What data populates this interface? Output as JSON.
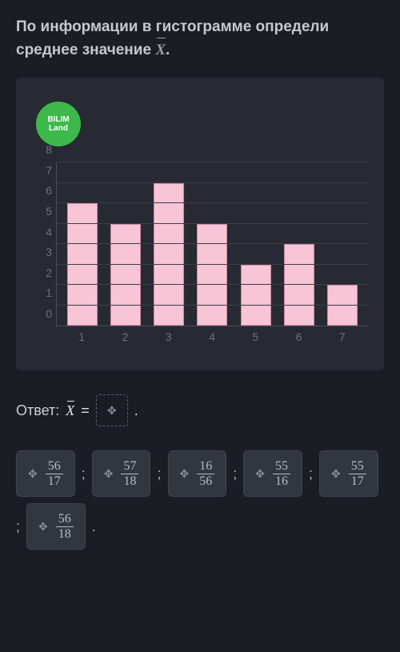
{
  "question": {
    "line1": "По информации в гистограмме определи",
    "line2_prefix": "среднее значение ",
    "line2_suffix": "."
  },
  "logo": {
    "line1": "BILIM",
    "line2": "Land"
  },
  "chart_data": {
    "type": "bar",
    "categories": [
      "1",
      "2",
      "3",
      "4",
      "5",
      "6",
      "7"
    ],
    "values": [
      6,
      5,
      7,
      5,
      3,
      4,
      2
    ],
    "y_ticks": [
      "0",
      "1",
      "2",
      "3",
      "4",
      "5",
      "6",
      "7",
      "8"
    ],
    "ylim": [
      0,
      8
    ]
  },
  "answer": {
    "label": "Ответ:",
    "equals": "=",
    "period": "."
  },
  "options": [
    {
      "num": "56",
      "den": "17"
    },
    {
      "num": "57",
      "den": "18"
    },
    {
      "num": "16",
      "den": "56"
    },
    {
      "num": "55",
      "den": "16"
    },
    {
      "num": "55",
      "den": "17"
    },
    {
      "num": "56",
      "den": "18"
    }
  ],
  "separators": {
    "semi": ";",
    "period": "."
  }
}
